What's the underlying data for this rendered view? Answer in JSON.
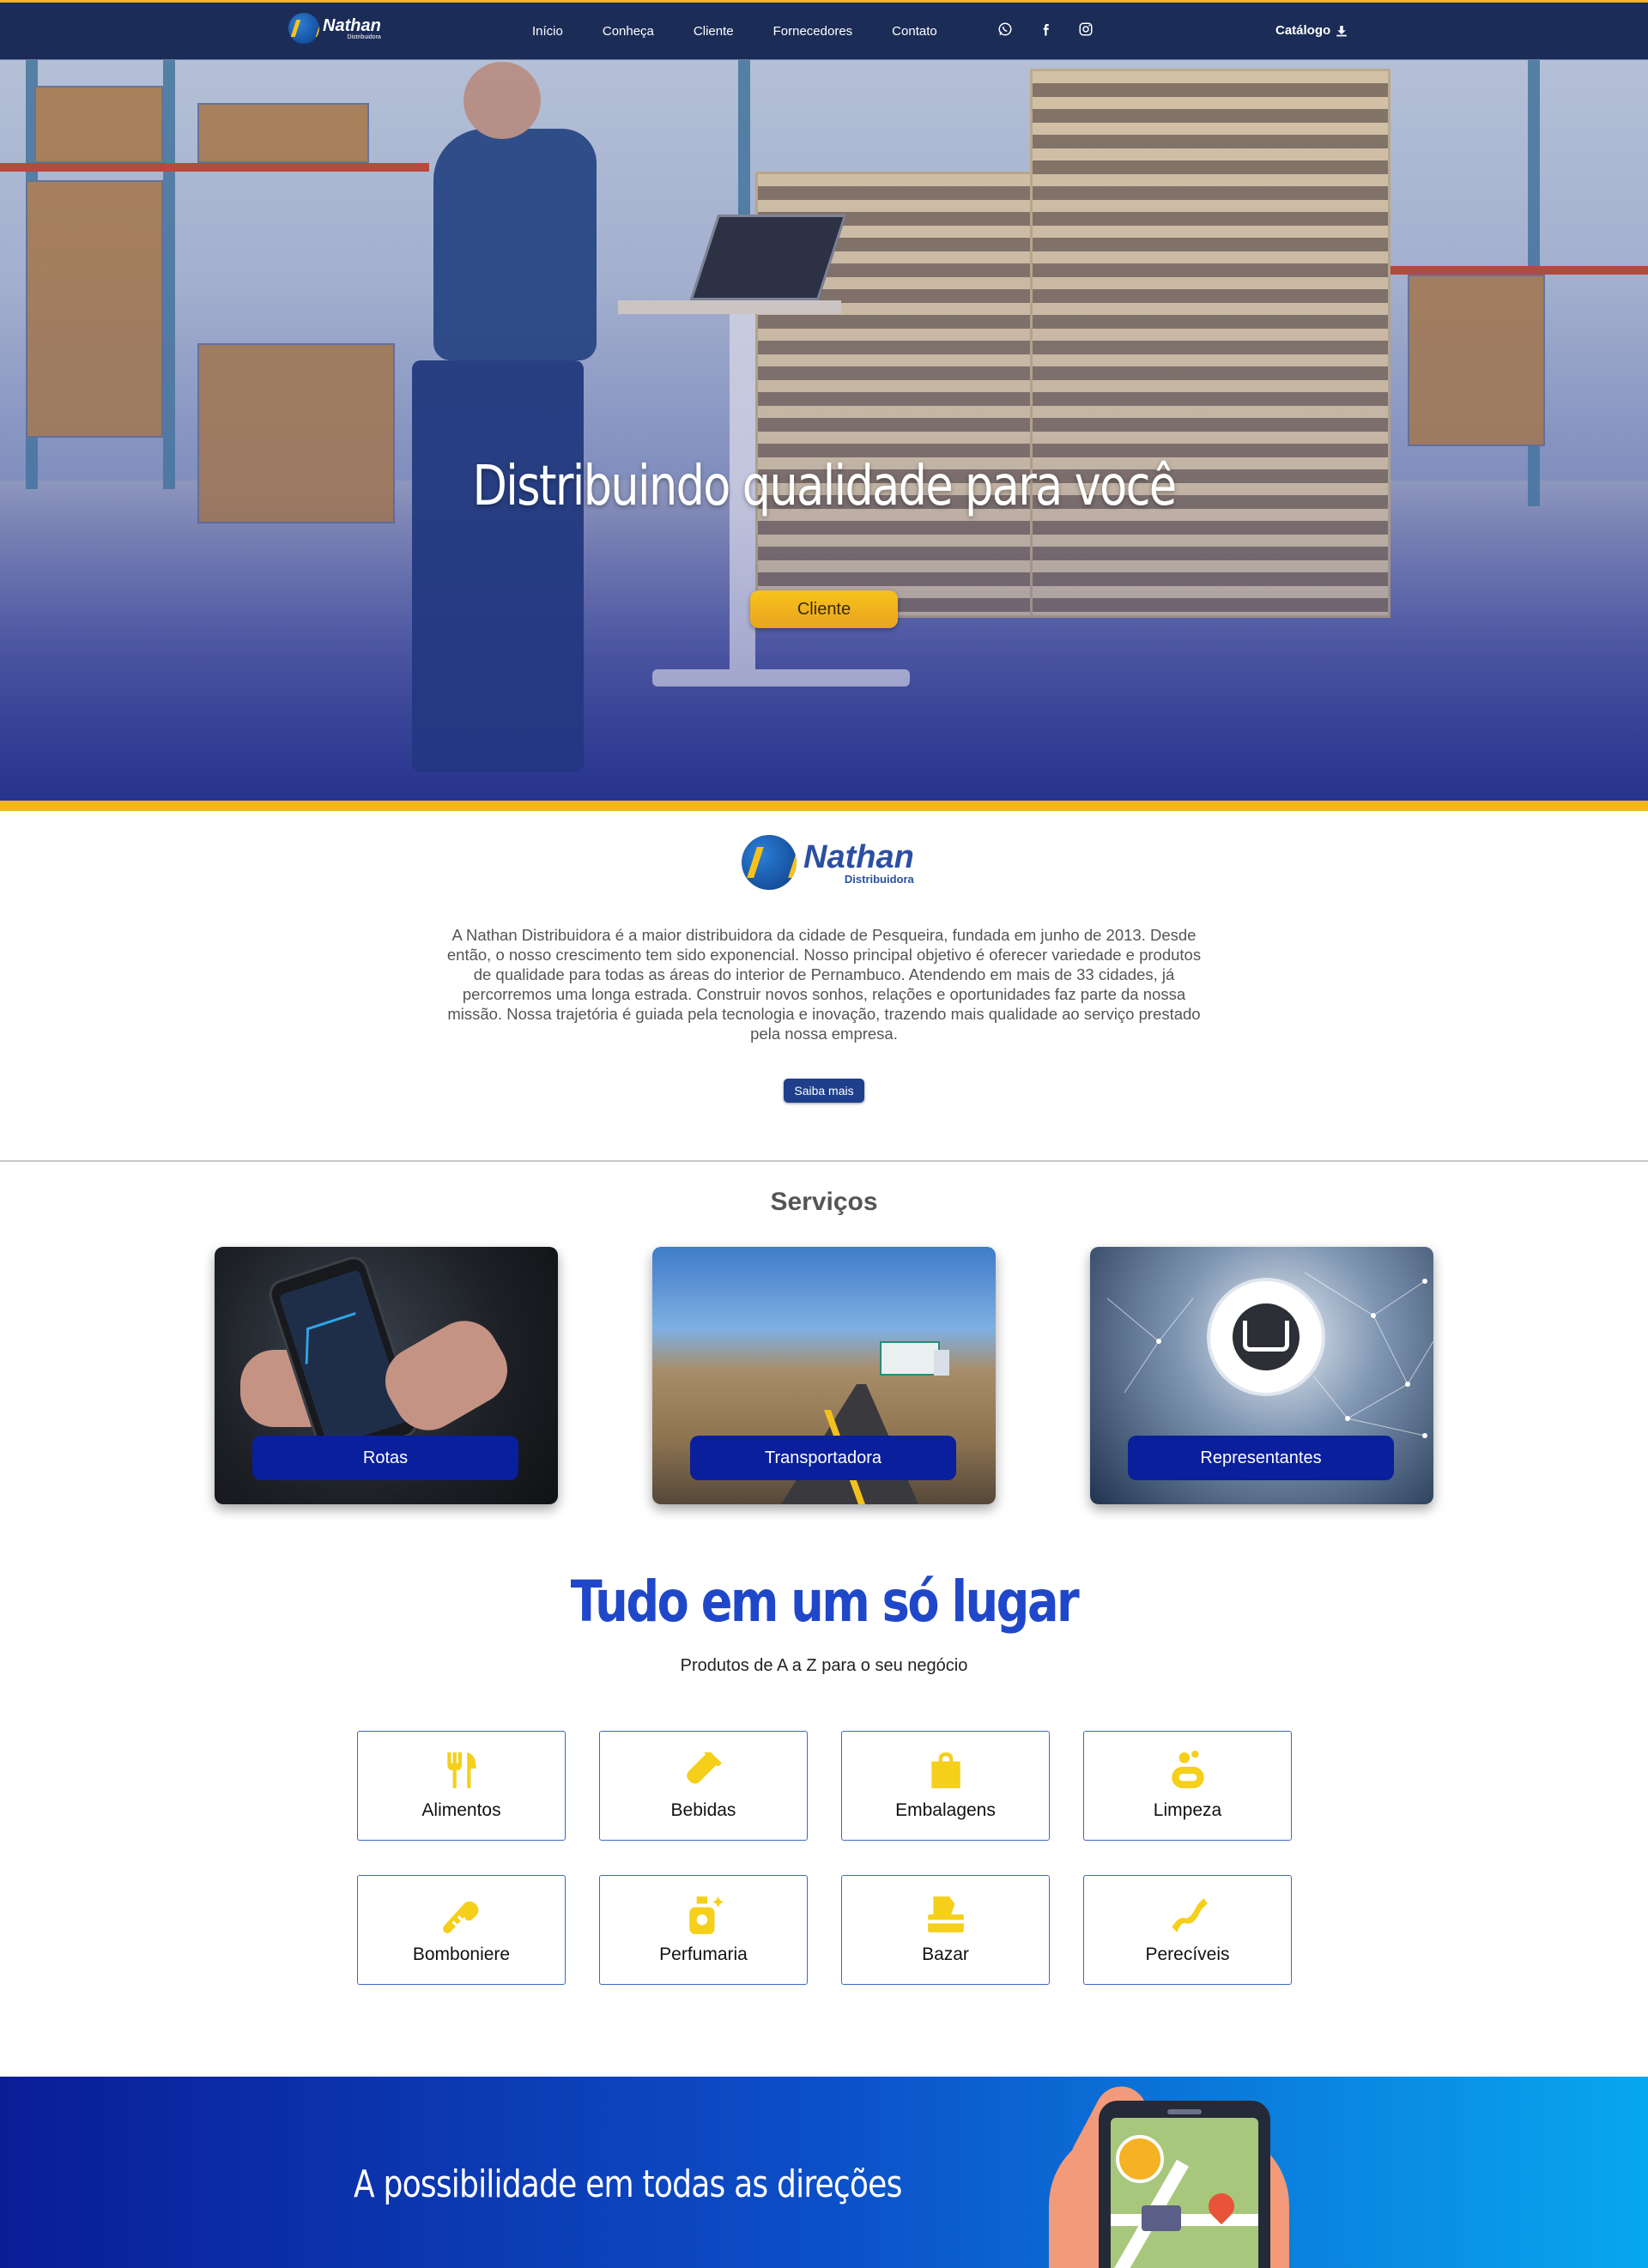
{
  "nav": {
    "logo_name": "Nathan",
    "logo_sub": "Distribuidora",
    "links": [
      "Início",
      "Conheça",
      "Cliente",
      "Fornecedores",
      "Contato"
    ],
    "social_icons": [
      "whatsapp-icon",
      "facebook-icon",
      "instagram-icon"
    ],
    "catalog_label": "Catálogo"
  },
  "hero": {
    "title": "Distribuindo qualidade para você",
    "button_label": "Cliente"
  },
  "about": {
    "logo_name": "Nathan",
    "logo_sub": "Distribuidora",
    "text": "A Nathan Distribuidora é a maior distribuidora da cidade de Pesqueira, fundada em junho de 2013. Desde então, o nosso crescimento tem sido exponencial. Nosso principal objetivo é oferecer variedade e produtos de qualidade para todas as áreas do interior de Pernambuco. Atendendo em mais de 33 cidades, já percorremos uma longa estrada. Construir novos sonhos, relações e oportunidades faz parte da nossa missão. Nossa trajetória é guiada pela tecnologia e inovação, trazendo mais qualidade ao serviço prestado pela nossa empresa.",
    "button_label": "Saiba mais"
  },
  "services": {
    "title": "Serviços",
    "cards": [
      {
        "label": "Rotas"
      },
      {
        "label": "Transportadora"
      },
      {
        "label": "Representantes"
      }
    ]
  },
  "products": {
    "title": "Tudo em um só lugar",
    "subtitle": "Produtos de A a Z para o seu negócio",
    "icon_color": "#f5cf1a",
    "border_color": "#3d68c6",
    "items": [
      {
        "label": "Alimentos",
        "icon": "utensils-icon"
      },
      {
        "label": "Bebidas",
        "icon": "bottle-icon"
      },
      {
        "label": "Embalagens",
        "icon": "shopping-bag-icon"
      },
      {
        "label": "Limpeza",
        "icon": "soap-icon"
      },
      {
        "label": "Bomboniere",
        "icon": "candy-cane-icon"
      },
      {
        "label": "Perfumaria",
        "icon": "perfume-icon"
      },
      {
        "label": "Bazar",
        "icon": "tissue-box-icon"
      },
      {
        "label": "Perecíveis",
        "icon": "bacon-icon"
      }
    ]
  },
  "banner": {
    "title": "A possibilidade em todas as direções"
  },
  "colors": {
    "nav_bg": "#1b2c57",
    "accent": "#f2b51d",
    "primary": "#1f47c9",
    "service_label_bg": "#0a1f9b"
  }
}
